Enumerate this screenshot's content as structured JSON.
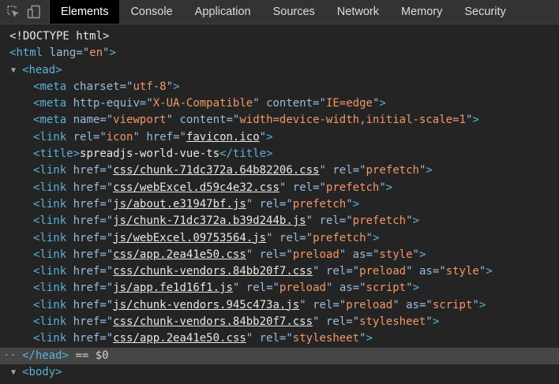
{
  "toolbar": {
    "inspect_icon": "inspect-element-icon",
    "device_icon": "device-toggle-icon",
    "tabs": [
      "Elements",
      "Console",
      "Application",
      "Sources",
      "Network",
      "Memory",
      "Security"
    ],
    "active_tab": "Elements"
  },
  "dom": {
    "doctype": "<!DOCTYPE html>",
    "html": {
      "tag": "html",
      "attr": "lang",
      "value": "en"
    },
    "head_tag": "head",
    "meta_charset": {
      "tag": "meta",
      "attr": "charset",
      "value": "utf-8"
    },
    "meta_http": {
      "tag": "meta",
      "attr1": "http-equiv",
      "value1": "X-UA-Compatible",
      "attr2": "content",
      "value2": "IE=edge"
    },
    "meta_viewport": {
      "tag": "meta",
      "attr1": "name",
      "value1": "viewport",
      "attr2": "content",
      "value2": "width=device-width,initial-scale=1"
    },
    "link_icon": {
      "tag": "link",
      "attr1": "rel",
      "value1": "icon",
      "attr2": "href",
      "value2": "favicon.ico"
    },
    "title": {
      "tag": "title",
      "text": "spreadjs-world-vue-ts"
    },
    "links": [
      {
        "href": "css/chunk-71dc372a.64b82206.css",
        "rel": "prefetch"
      },
      {
        "href": "css/webExcel.d59c4e32.css",
        "rel": "prefetch"
      },
      {
        "href": "js/about.e31947bf.js",
        "rel": "prefetch"
      },
      {
        "href": "js/chunk-71dc372a.b39d244b.js",
        "rel": "prefetch"
      },
      {
        "href": "js/webExcel.09753564.js",
        "rel": "prefetch"
      },
      {
        "href": "css/app.2ea41e50.css",
        "rel": "preload",
        "as": "style"
      },
      {
        "href": "css/chunk-vendors.84bb20f7.css",
        "rel": "preload",
        "as": "style"
      },
      {
        "href": "js/app.fe1d16f1.js",
        "rel": "preload",
        "as": "script"
      },
      {
        "href": "js/chunk-vendors.945c473a.js",
        "rel": "preload",
        "as": "script"
      },
      {
        "href": "css/chunk-vendors.84bb20f7.css",
        "rel": "stylesheet"
      },
      {
        "href": "css/app.2ea41e50.css",
        "rel": "stylesheet"
      }
    ],
    "head_close": "</head>",
    "selected_marker": "== $0",
    "body_tag": "body"
  },
  "colors": {
    "tag": "#5db0d7",
    "attribute": "#9bbbdc",
    "value": "#f29766",
    "selection": "#454545",
    "background": "#242424"
  }
}
